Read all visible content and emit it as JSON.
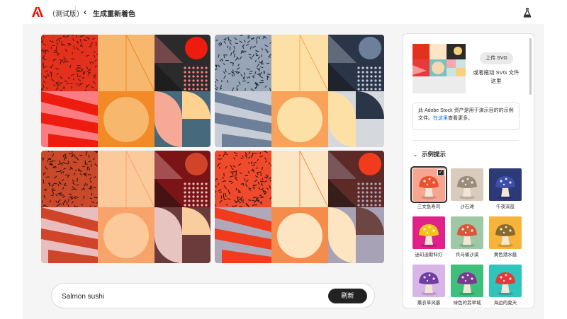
{
  "header": {
    "app_title": "（测试版）",
    "page_title": "生成重新着色",
    "brand_color": "#eb1000"
  },
  "prompt": {
    "value": "Salmon sushi",
    "refresh_label": "刷新"
  },
  "side_panel": {
    "upload_label": "上传 SVG",
    "drag_text": "或者拖动 SVG 文件这里",
    "stock_note_prefix": "此 Adobe Stock 资产是用于演示目的的示例文件。",
    "stock_link": "在这里",
    "stock_note_suffix": "查看更多。",
    "section_title": "示例提示",
    "samples": [
      {
        "label": "三文鱼寿司",
        "bg": "#f6a590",
        "cap": "#e8532f",
        "selected": true
      },
      {
        "label": "沙石滩",
        "bg": "#d9ccbd",
        "cap": "#9b8b7b",
        "selected": false
      },
      {
        "label": "午夜深蓝",
        "bg": "#2c3a78",
        "cap": "#3e4fa8",
        "selected": false
      },
      {
        "label": "迷幻迪斯科灯",
        "bg": "#e0218a",
        "cap": "#f2c418",
        "selected": false
      },
      {
        "label": "兵马俑沙漠",
        "bg": "#9fc8a6",
        "cap": "#d8583c",
        "selected": false
      },
      {
        "label": "黄色潜水艇",
        "bg": "#f6b43a",
        "cap": "#8a6a2c",
        "selected": false
      },
      {
        "label": "薰衣草风暴",
        "bg": "#d9b6e8",
        "cap": "#6e3f9e",
        "selected": false
      },
      {
        "label": "绿色的翡翠城",
        "bg": "#3ec07c",
        "cap": "#7a3a8e",
        "selected": false
      },
      {
        "label": "海边的夏天",
        "bg": "#2fc5bd",
        "cap": "#e23a3a",
        "selected": false
      }
    ]
  },
  "variants": [
    {
      "c1": "#e4311e",
      "c1dot": "#5a1a10",
      "c2": "#f7b76c",
      "c3": "#2b2b2b",
      "c4": "#ee1c0f",
      "c5": "#fb7d82",
      "c6": "#f28a27",
      "c7": "#46697c",
      "c8": "#f6a997",
      "c9": "#ffd28f"
    },
    {
      "c1": "#97a5b6",
      "c1dot": "#2a3240",
      "c2": "#fde0a6",
      "c3": "#2a3548",
      "c4": "#6e8099",
      "c5": "#c7cdd6",
      "c6": "#f9a35a",
      "c7": "#d5d8dc",
      "c8": "#fde0a6",
      "c9": "#2a3548"
    },
    {
      "c1": "#c9492a",
      "c1dot": "#3a1610",
      "c2": "#fcc99b",
      "c3": "#7b1416",
      "c4": "#d0442a",
      "c5": "#e9bdbd",
      "c6": "#f8a36a",
      "c7": "#6b3a3a",
      "c8": "#e8c4c0",
      "c9": "#f9cd9e"
    },
    {
      "c1": "#f04a2c",
      "c1dot": "#3a1612",
      "c2": "#fde5c2",
      "c3": "#5d2a28",
      "c4": "#f23b1c",
      "c5": "#b0a8b8",
      "c6": "#f58c4b",
      "c7": "#a8a2b6",
      "c8": "#fde5c2",
      "c9": "#6b4642"
    }
  ]
}
